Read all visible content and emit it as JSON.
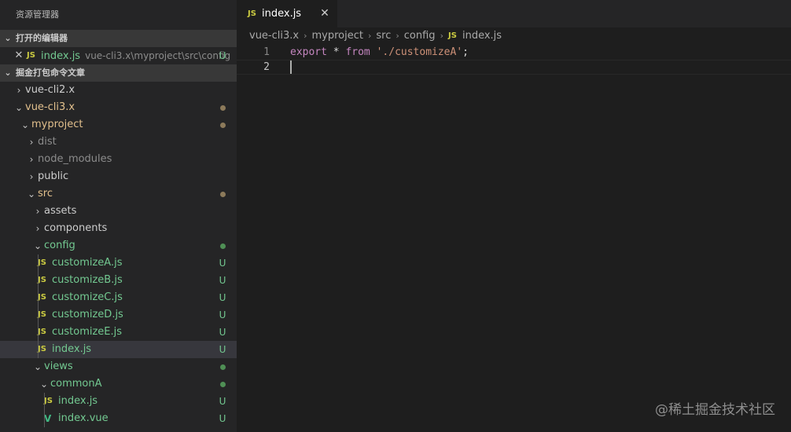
{
  "explorer": {
    "title": "资源管理器",
    "open_editors": {
      "header": "打开的编辑器",
      "items": [
        {
          "name": "index.js",
          "path": "vue-cli3.x\\myproject\\src\\config",
          "status": "U"
        }
      ]
    },
    "workspace": {
      "header": "掘金打包命令文章",
      "items": [
        {
          "label": "vue-cli2.x",
          "chevron": "›",
          "status": ""
        },
        {
          "label": "vue-cli3.x",
          "chevron": "⌄",
          "status": "●"
        },
        {
          "label": "myproject",
          "chevron": "⌄",
          "status": "●"
        },
        {
          "label": "dist",
          "chevron": "›",
          "status": ""
        },
        {
          "label": "node_modules",
          "chevron": "›",
          "status": ""
        },
        {
          "label": "public",
          "chevron": "›",
          "status": ""
        },
        {
          "label": "src",
          "chevron": "⌄",
          "status": "●"
        },
        {
          "label": "assets",
          "chevron": "›",
          "status": ""
        },
        {
          "label": "components",
          "chevron": "›",
          "status": ""
        },
        {
          "label": "config",
          "chevron": "⌄",
          "status": "●"
        },
        {
          "label": "customizeA.js",
          "icon": "JS",
          "status": "U"
        },
        {
          "label": "customizeB.js",
          "icon": "JS",
          "status": "U"
        },
        {
          "label": "customizeC.js",
          "icon": "JS",
          "status": "U"
        },
        {
          "label": "customizeD.js",
          "icon": "JS",
          "status": "U"
        },
        {
          "label": "customizeE.js",
          "icon": "JS",
          "status": "U"
        },
        {
          "label": "index.js",
          "icon": "JS",
          "status": "U"
        },
        {
          "label": "views",
          "chevron": "⌄",
          "status": "●"
        },
        {
          "label": "commonA",
          "chevron": "⌄",
          "status": "●"
        },
        {
          "label": "index.js",
          "icon": "JS",
          "status": "U"
        },
        {
          "label": "index.vue",
          "icon": "V",
          "status": "U"
        }
      ]
    }
  },
  "editor": {
    "tab": {
      "label": "index.js",
      "icon": "JS",
      "close": "✕"
    },
    "breadcrumb": [
      "vue-cli3.x",
      "myproject",
      "src",
      "config",
      "index.js"
    ],
    "breadcrumb_icon": "JS",
    "lines": [
      {
        "number": "1",
        "keyword": "export",
        "op": " * ",
        "keyword2": "from",
        "string": "'./customizeA'",
        "end": ";"
      },
      {
        "number": "2"
      }
    ]
  },
  "watermark": "@稀土掘金技术社区",
  "colors": {
    "accent_js": "#cbcb41",
    "untracked": "#73c991",
    "modified": "#e2c08d",
    "vue": "#41b883"
  }
}
